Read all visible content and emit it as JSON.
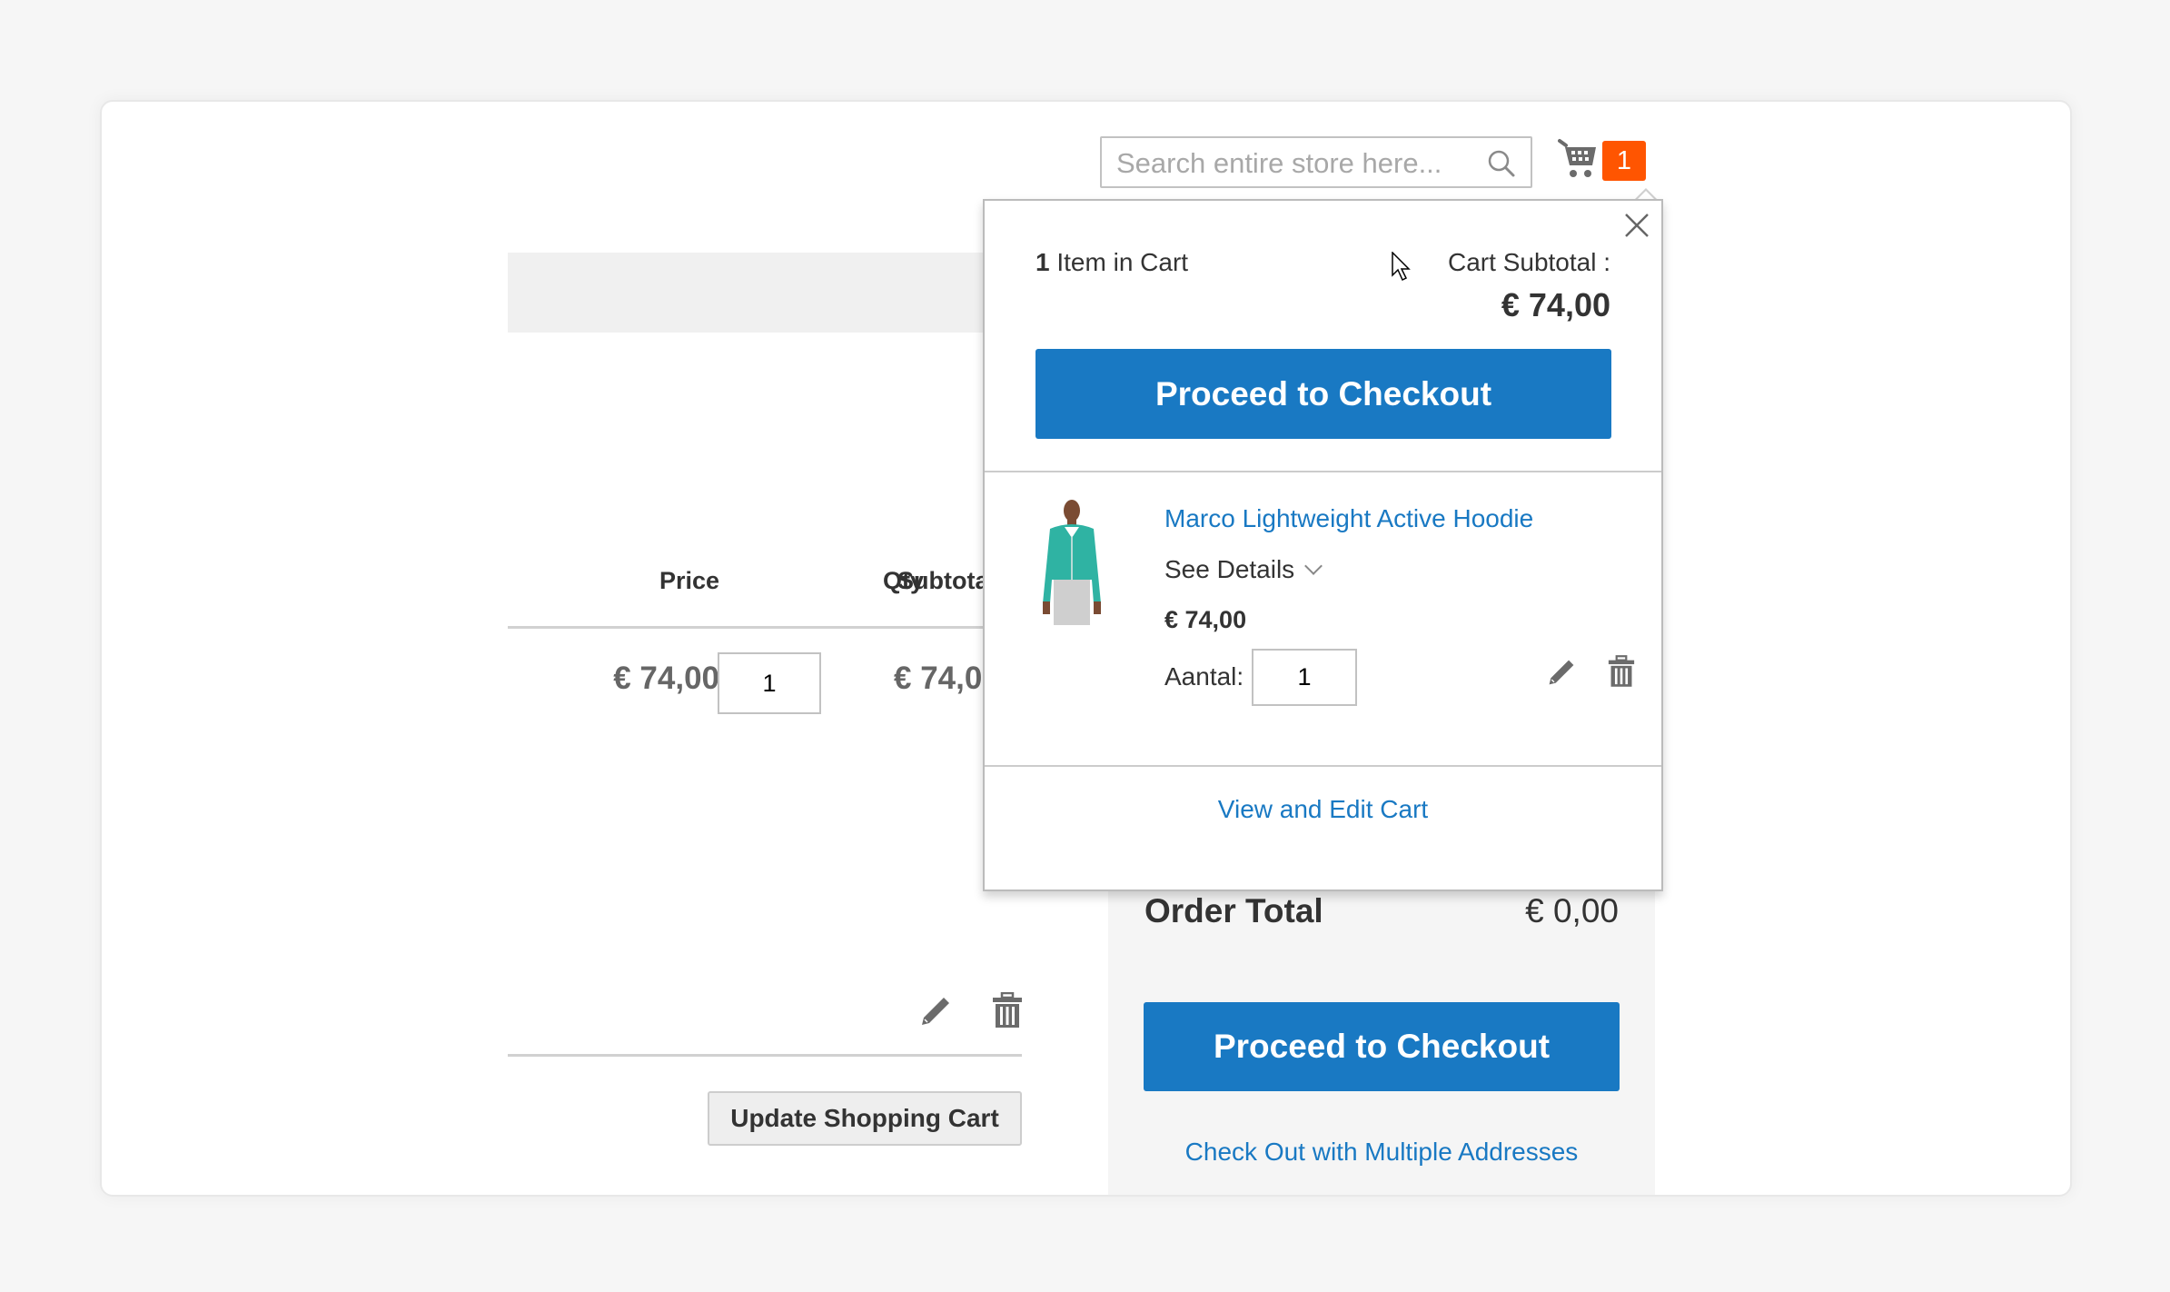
{
  "header": {
    "search_placeholder": "Search entire store here...",
    "search_icon": "search-icon",
    "cart_icon": "shopping-cart-icon",
    "cart_count": "1",
    "badge_color": "#ff5501"
  },
  "cart_table": {
    "columns": [
      "Price",
      "Qty",
      "Subtotal"
    ],
    "subtotal_visible": "Subtota",
    "rows": [
      {
        "price": "€ 74,00",
        "qty": "1",
        "subtotal": "€ 74,0"
      }
    ],
    "update_button": "Update Shopping Cart",
    "edit_icon": "pencil-icon",
    "delete_icon": "trash-icon"
  },
  "summary": {
    "order_total_label": "Order Total",
    "order_total_value": "€ 0,00",
    "checkout_button": "Proceed to Checkout",
    "multi_address_link": "Check Out with Multiple Addresses",
    "accent_color": "#1979c3"
  },
  "minicart": {
    "items_count": "1",
    "items_label": "Item in Cart",
    "subtotal_label": "Cart Subtotal :",
    "subtotal_value": "€ 74,00",
    "checkout_button": "Proceed to Checkout",
    "close_icon": "close-icon",
    "items": [
      {
        "name": "Marco Lightweight Active Hoodie",
        "see_details": "See Details",
        "price": "€ 74,00",
        "qty_label": "Aantal:",
        "qty": "1"
      }
    ],
    "view_edit_link": "View and Edit Cart"
  }
}
